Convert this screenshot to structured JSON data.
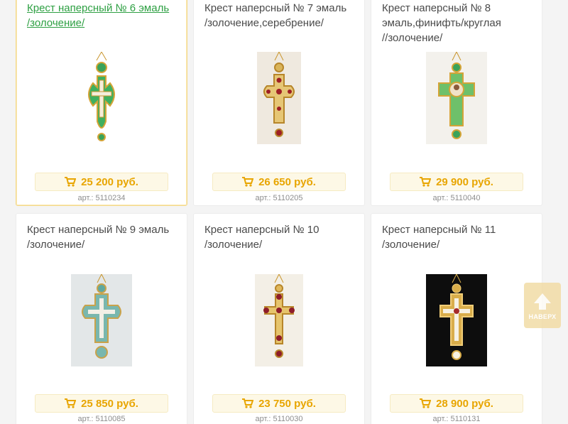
{
  "products": [
    {
      "title_line1": "Крест наперсный № 6 эмаль",
      "title_line2": "/золочение/",
      "title_line3": "",
      "price": "25 200 руб.",
      "article": "арт.: 5110234",
      "active": true,
      "image": "green-enamel-cross"
    },
    {
      "title_line1": "Крест наперсный № 7 эмаль",
      "title_line2": "/золочение,серебрение/",
      "title_line3": "",
      "price": "26 650 руб.",
      "article": "арт.: 5110205",
      "active": false,
      "image": "gold-red-stone-cross"
    },
    {
      "title_line1": "Крест наперсный № 8",
      "title_line2": "эмаль,финифть/круглая",
      "title_line3": "//золочение/",
      "price": "29 900 руб.",
      "article": "арт.: 5110040",
      "active": false,
      "image": "green-icon-cross"
    },
    {
      "title_line1": "Крест наперсный № 9 эмаль",
      "title_line2": "/золочение/",
      "title_line3": "",
      "price": "25 850 руб.",
      "article": "арт.: 5110085",
      "active": false,
      "image": "teal-enamel-cross"
    },
    {
      "title_line1": "Крест наперсный № 10",
      "title_line2": "/золочение/",
      "title_line3": "",
      "price": "23 750 руб.",
      "article": "арт.: 5110030",
      "active": false,
      "image": "gold-garnet-cross"
    },
    {
      "title_line1": "Крест наперсный № 11",
      "title_line2": "/золочение/",
      "title_line3": "",
      "price": "28 900 руб.",
      "article": "арт.: 5110131",
      "active": false,
      "image": "gold-cross-dark-background"
    }
  ],
  "back_to_top": {
    "label": "НАВЕРХ",
    "icon": "arrow-up-icon"
  },
  "colors": {
    "price": "#e8a500",
    "price_bg": "#fdf8e6",
    "active_title": "#2ea043",
    "active_border": "#f3d889",
    "gold": "#d4a437"
  }
}
